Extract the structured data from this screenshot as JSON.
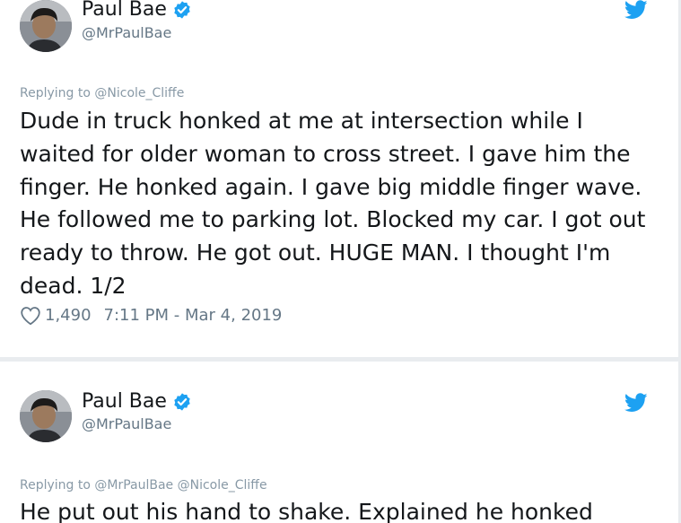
{
  "tweets": [
    {
      "author_name": "Paul Bae",
      "author_handle": "@MrPaulBae",
      "replying_to": "Replying to @Nicole_Cliffe",
      "text": "Dude in truck honked at me at intersection while I waited for older woman to cross street. I gave him the finger. He honked again. I gave big middle finger wave. He followed me to parking lot. Blocked my car. I got out ready to throw. He got out. HUGE MAN. I thought I'm dead. 1/2",
      "likes": "1,490",
      "timestamp": "7:11 PM - Mar 4, 2019",
      "icons": [
        "verified-badge-icon",
        "twitter-bird-icon",
        "heart-icon"
      ]
    },
    {
      "author_name": "Paul Bae",
      "author_handle": "@MrPaulBae",
      "replying_to": "Replying to @MrPaulBae @Nicole_Cliffe",
      "text": "He put out his hand to shake. Explained he honked",
      "icons": [
        "verified-badge-icon",
        "twitter-bird-icon"
      ]
    }
  ],
  "colors": {
    "verified_blue": "#1da1f2",
    "secondary_text": "#657786",
    "reply_text": "#8899a6",
    "primary_text": "#14171a",
    "page_background": "#e9ecef"
  }
}
